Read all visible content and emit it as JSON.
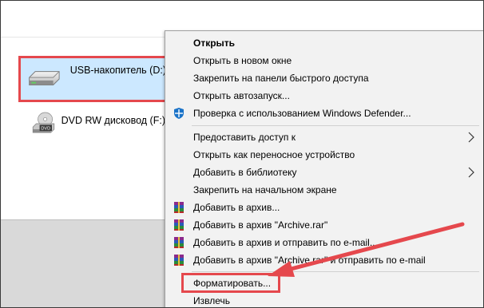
{
  "explorer": {
    "drives": [
      {
        "label": "USB-накопитель (D:)",
        "icon": "usb-drive-icon"
      },
      {
        "label": "DVD RW дисковод (F:)",
        "icon": "dvd-drive-icon",
        "badge": "DVD"
      }
    ]
  },
  "context_menu": {
    "items": [
      {
        "label": "Открыть",
        "bold": true
      },
      {
        "label": "Открыть в новом окне"
      },
      {
        "label": "Закрепить на панели быстрого доступа"
      },
      {
        "label": "Открыть автозапуск..."
      },
      {
        "label": "Проверка с использованием Windows Defender...",
        "icon": "windows-defender-icon"
      },
      {
        "label": "Предоставить доступ к",
        "submenu": true
      },
      {
        "label": "Открыть как переносное устройство"
      },
      {
        "label": "Добавить в библиотеку",
        "submenu": true
      },
      {
        "label": "Закрепить на начальном экране"
      },
      {
        "label": "Добавить в архив...",
        "icon": "winrar-icon"
      },
      {
        "label": "Добавить в архив \"Archive.rar\"",
        "icon": "winrar-icon"
      },
      {
        "label": "Добавить в архив и отправить по e-mail...",
        "icon": "winrar-icon"
      },
      {
        "label": "Добавить в архив \"Archive.rar\" и отправить по e-mail",
        "icon": "winrar-icon"
      },
      {
        "label": "Форматировать..."
      },
      {
        "label": "Извлечь"
      }
    ]
  },
  "colors": {
    "selection": "#cce8ff",
    "annotation": "#e5484d",
    "menu_background": "#f2f2f2"
  }
}
